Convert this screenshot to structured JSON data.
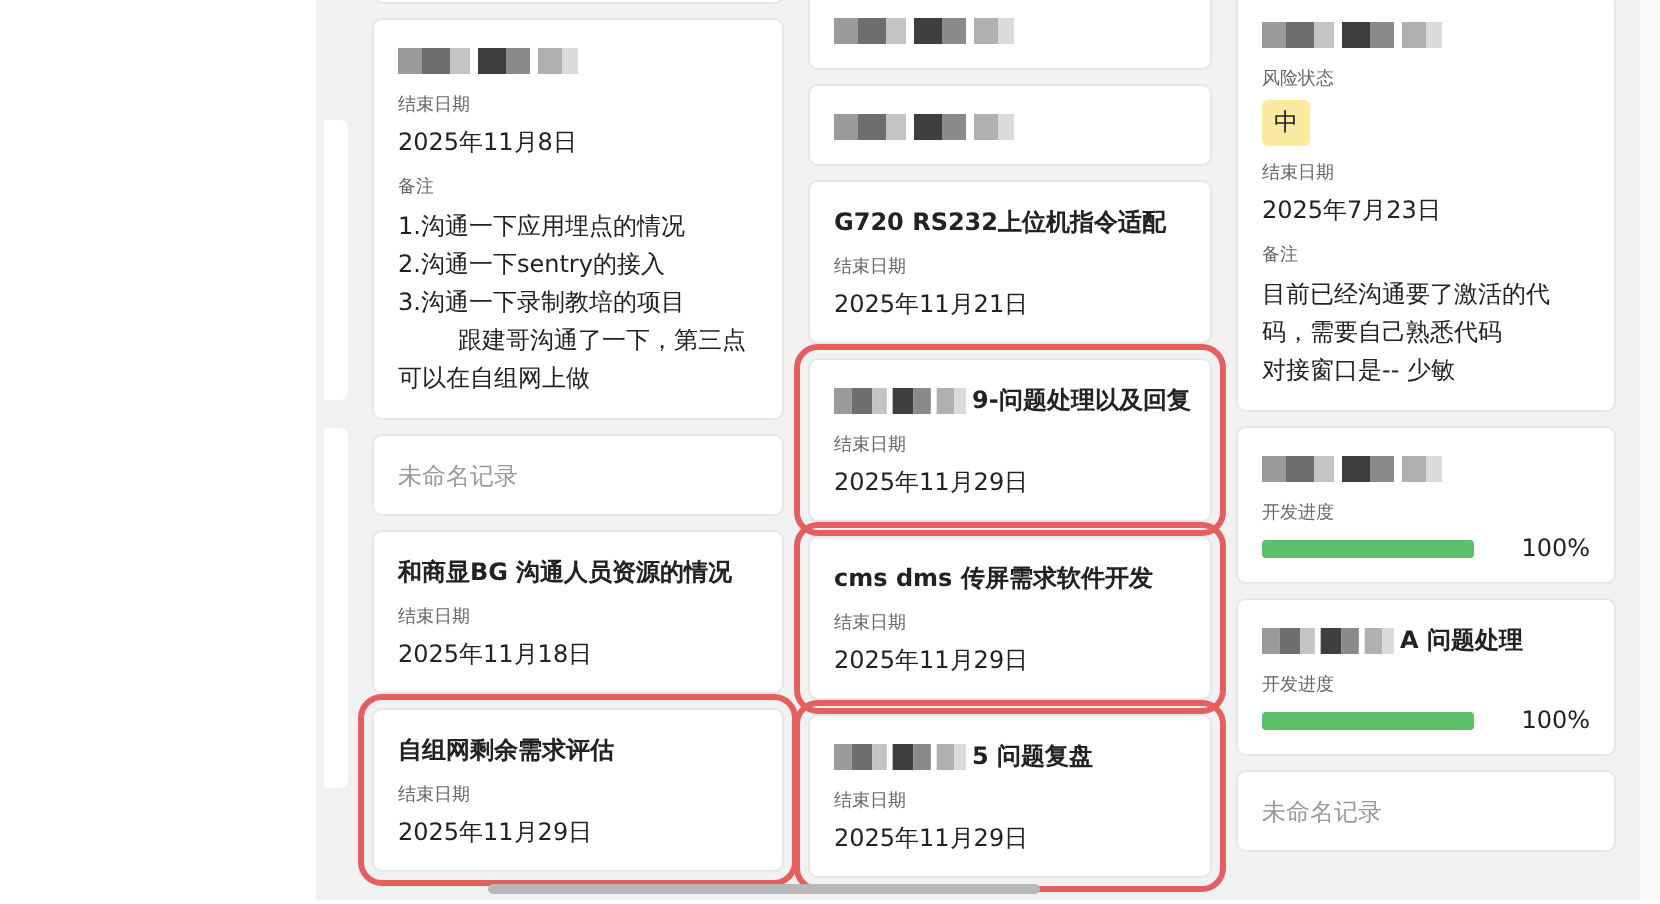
{
  "columns": [
    {
      "cards": [
        {
          "redacted": true,
          "fields": [
            {
              "kind": "date",
              "label": "结束日期",
              "value": "2025年11月8日"
            },
            {
              "kind": "note",
              "label": "备注",
              "lines": [
                {
                  "text": "1.沟通一下应用埋点的情况",
                  "indented": false
                },
                {
                  "text": "2.沟通一下sentry的接入",
                  "indented": false
                },
                {
                  "text": "3.沟通一下录制教培的项目",
                  "indented": false
                },
                {
                  "text": "跟建哥沟通了一下，第三点可以在自组网上做",
                  "indented": true
                }
              ]
            }
          ]
        },
        {
          "title": "未命名记录",
          "untitled": true
        },
        {
          "title": "和商显BG 沟通人员资源的情况",
          "fields": [
            {
              "kind": "date",
              "label": "结束日期",
              "value": "2025年11月18日"
            }
          ]
        },
        {
          "title": "自组网剩余需求评估",
          "highlighted": true,
          "fields": [
            {
              "kind": "date",
              "label": "结束日期",
              "value": "2025年11月29日"
            }
          ]
        }
      ]
    },
    {
      "cards": [
        {
          "redacted": true
        },
        {
          "redacted": true
        },
        {
          "title": "G720 RS232上位机指令适配",
          "fields": [
            {
              "kind": "date",
              "label": "结束日期",
              "value": "2025年11月21日"
            }
          ]
        },
        {
          "redacted": true,
          "title": "9-问题处理以及回复",
          "highlighted": true,
          "fields": [
            {
              "kind": "date",
              "label": "结束日期",
              "value": "2025年11月29日"
            }
          ]
        },
        {
          "title": "cms dms 传屏需求软件开发",
          "highlighted": true,
          "fields": [
            {
              "kind": "date",
              "label": "结束日期",
              "value": "2025年11月29日"
            }
          ]
        },
        {
          "redacted": true,
          "title": "5 问题复盘",
          "highlighted": true,
          "fields": [
            {
              "kind": "date",
              "label": "结束日期",
              "value": "2025年11月29日"
            }
          ]
        }
      ]
    },
    {
      "cards": [
        {
          "redacted": true,
          "fields": [
            {
              "kind": "badge",
              "label": "风险状态",
              "value": "中"
            },
            {
              "kind": "date",
              "label": "结束日期",
              "value": "2025年7月23日"
            },
            {
              "kind": "note",
              "label": "备注",
              "lines": [
                {
                  "text": "目前已经沟通要了激活的代码，需要自己熟悉代码",
                  "indented": false
                },
                {
                  "text": "对接窗口是-- 少敏",
                  "indented": false
                }
              ]
            }
          ]
        },
        {
          "redacted": true,
          "fields": [
            {
              "kind": "progress",
              "label": "开发进度",
              "level": 1,
              "reading": "100%"
            }
          ]
        },
        {
          "redacted": true,
          "title": "A 问题处理",
          "fields": [
            {
              "kind": "progress",
              "label": "开发进度",
              "level": 1,
              "reading": "100%"
            }
          ]
        },
        {
          "title": "未命名记录",
          "untitled": true
        }
      ]
    }
  ]
}
